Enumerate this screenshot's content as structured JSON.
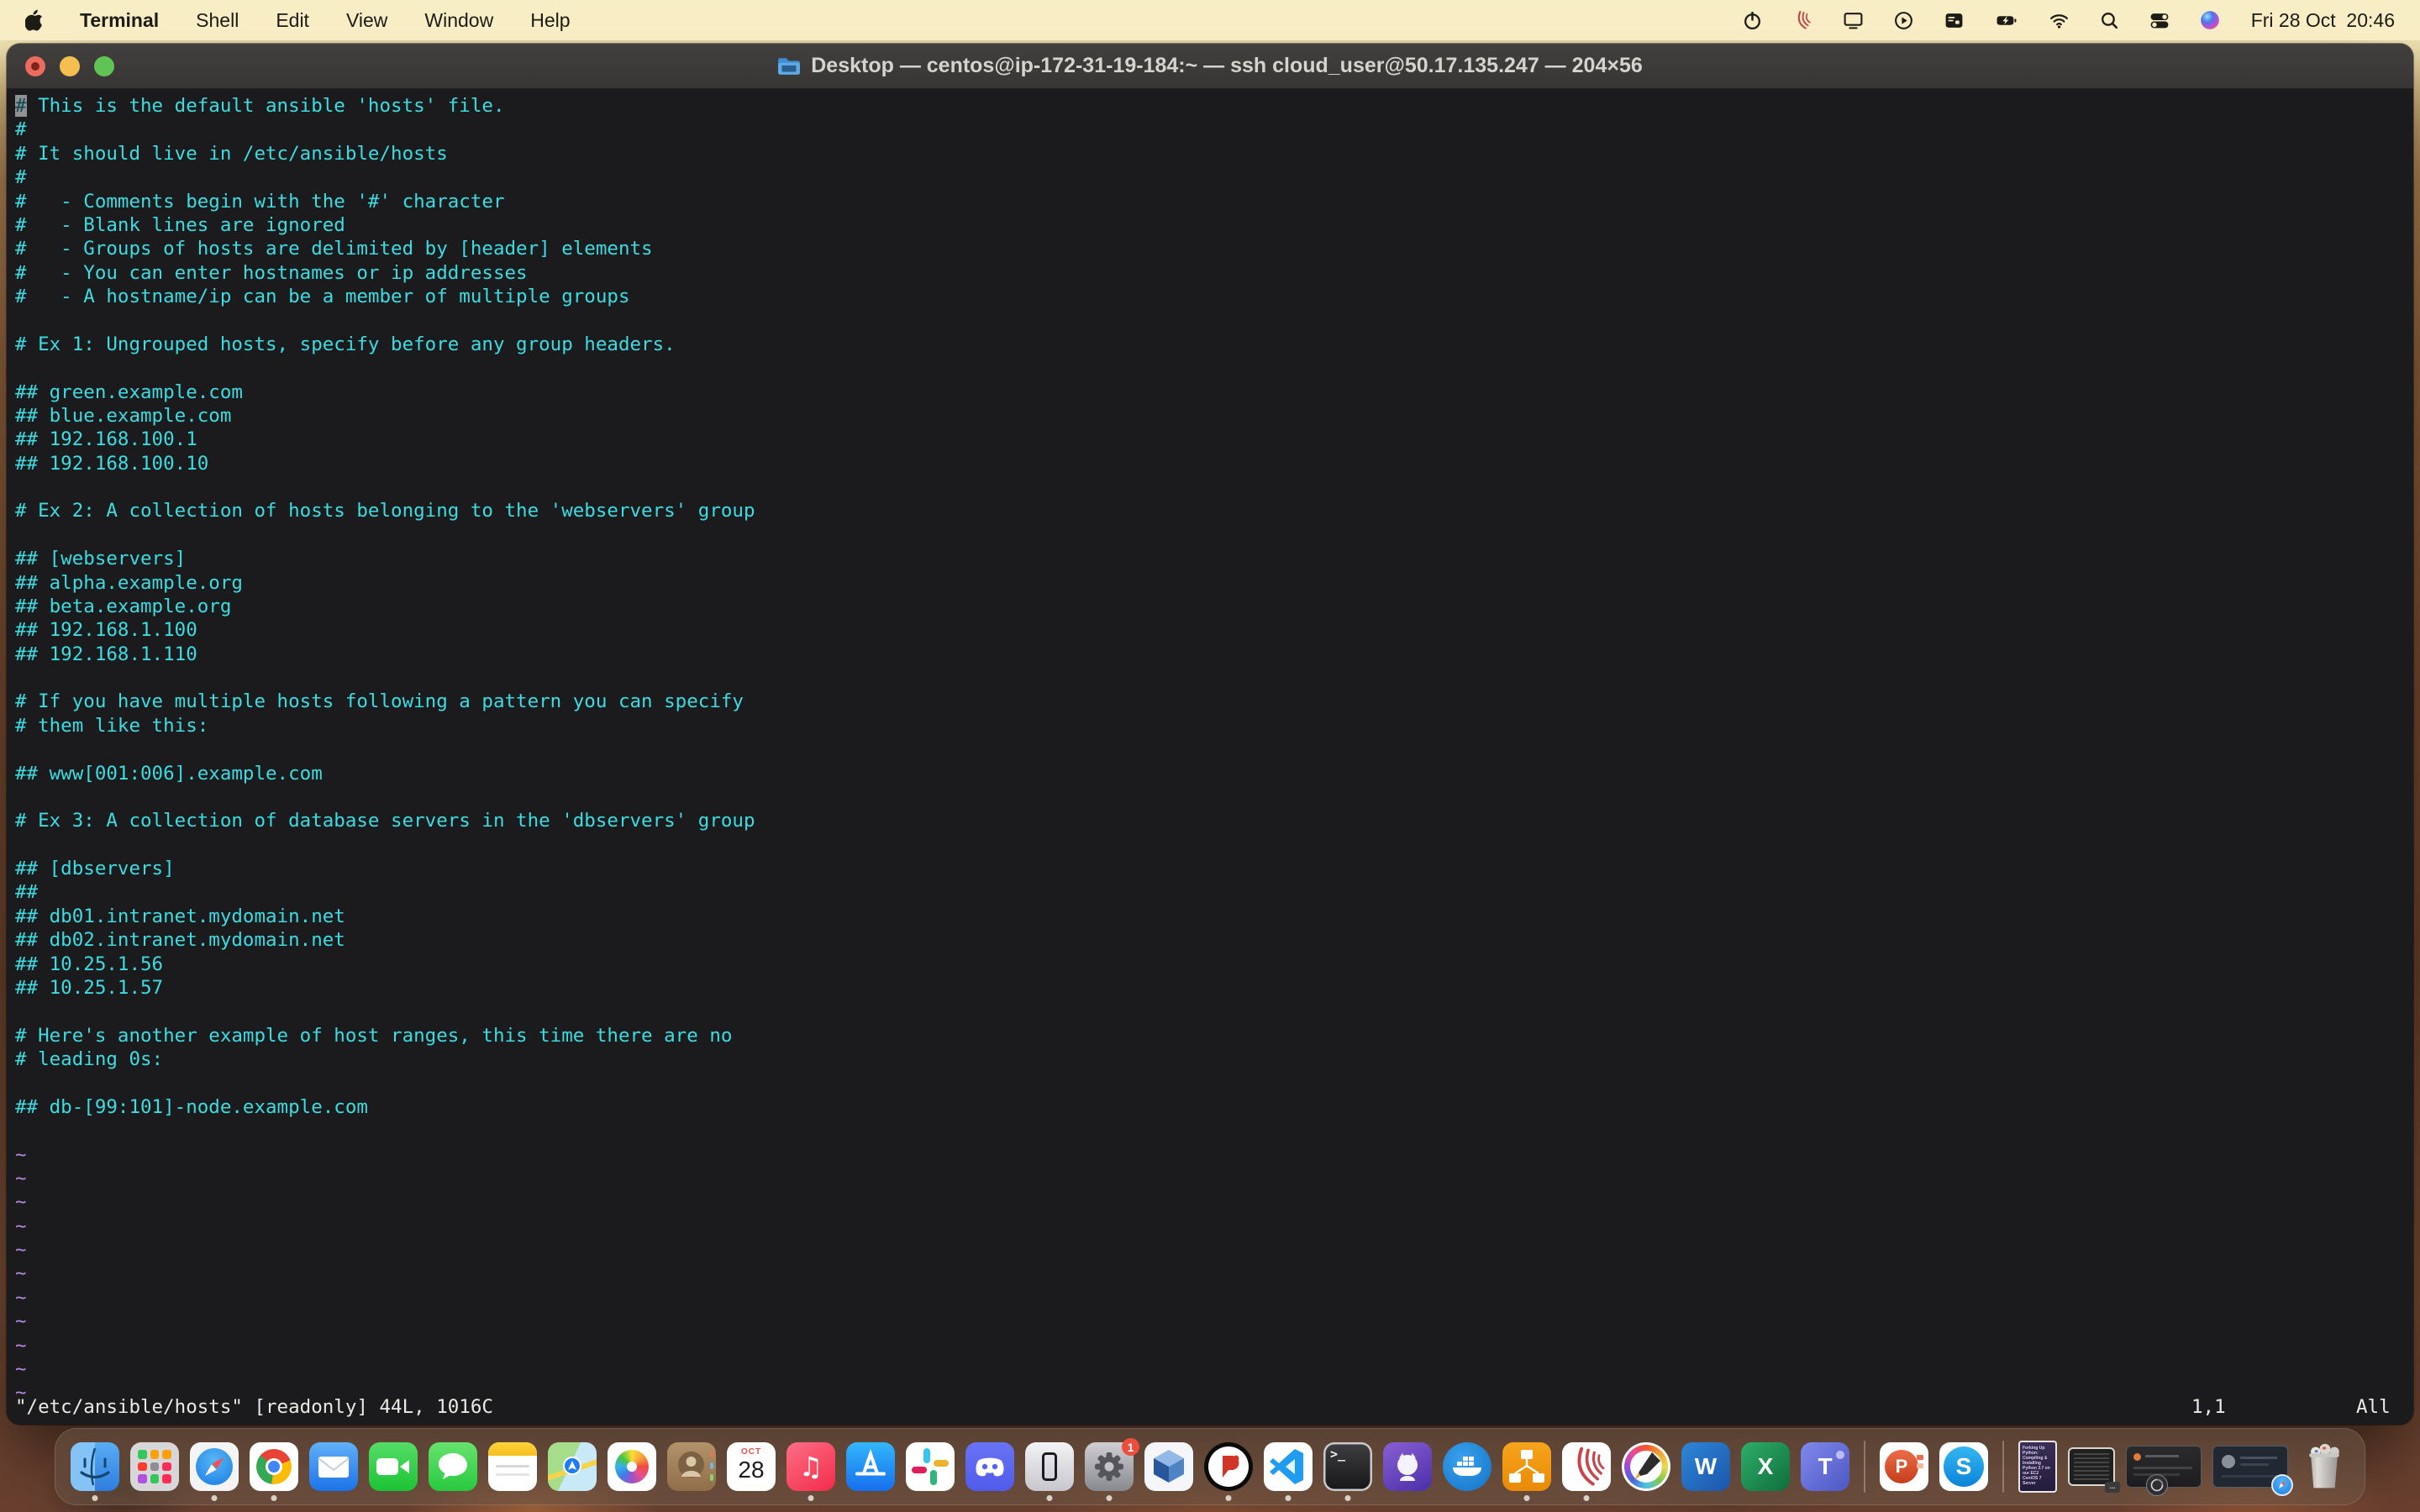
{
  "menubar": {
    "items": [
      {
        "label": "Terminal",
        "bold": true
      },
      {
        "label": "Shell"
      },
      {
        "label": "Edit"
      },
      {
        "label": "View"
      },
      {
        "label": "Window"
      },
      {
        "label": "Help"
      }
    ],
    "status_icons": [
      "power",
      "labex-waves",
      "screen-mirroring",
      "now-playing",
      "keyboard-window",
      "battery-charging",
      "wifi",
      "spotlight",
      "control-center",
      "siri"
    ],
    "clock": "Fri 28 Oct  20:46"
  },
  "window": {
    "title": "Desktop — centos@ip-172-31-19-184:~ — ssh cloud_user@50.17.135.247 — 204×56"
  },
  "terminal": {
    "cursor": {
      "row": 0,
      "col": 0
    },
    "lines": [
      "# This is the default ansible 'hosts' file.",
      "#",
      "# It should live in /etc/ansible/hosts",
      "#",
      "#   - Comments begin with the '#' character",
      "#   - Blank lines are ignored",
      "#   - Groups of hosts are delimited by [header] elements",
      "#   - You can enter hostnames or ip addresses",
      "#   - A hostname/ip can be a member of multiple groups",
      "",
      "# Ex 1: Ungrouped hosts, specify before any group headers.",
      "",
      "## green.example.com",
      "## blue.example.com",
      "## 192.168.100.1",
      "## 192.168.100.10",
      "",
      "# Ex 2: A collection of hosts belonging to the 'webservers' group",
      "",
      "## [webservers]",
      "## alpha.example.org",
      "## beta.example.org",
      "## 192.168.1.100",
      "## 192.168.1.110",
      "",
      "# If you have multiple hosts following a pattern you can specify",
      "# them like this:",
      "",
      "## www[001:006].example.com",
      "",
      "# Ex 3: A collection of database servers in the 'dbservers' group",
      "",
      "## [dbservers]",
      "##",
      "## db01.intranet.mydomain.net",
      "## db02.intranet.mydomain.net",
      "## 10.25.1.56",
      "## 10.25.1.57",
      "",
      "# Here's another example of host ranges, this time there are no",
      "# leading 0s:",
      "",
      "## db-[99:101]-node.example.com",
      ""
    ],
    "tilde": "~",
    "tilde_count": 11,
    "status": {
      "left": "\"/etc/ansible/hosts\" [readonly] 44L, 1016C",
      "ruler": "1,1",
      "scroll": "All"
    },
    "colors": {
      "bg": "#1b1a1c",
      "text": "#3adde2",
      "tilde": "#b487e3",
      "status": "#eceae6",
      "cursor_bg": "#8f9193",
      "cursor_text": "#0c4a50"
    }
  },
  "dock": {
    "items": [
      {
        "name": "finder",
        "running": true
      },
      {
        "name": "launchpad",
        "running": false
      },
      {
        "name": "safari",
        "running": true
      },
      {
        "name": "chrome",
        "running": true
      },
      {
        "name": "mail",
        "running": false
      },
      {
        "name": "facetime",
        "running": false
      },
      {
        "name": "messages",
        "running": false
      },
      {
        "name": "notes",
        "running": false
      },
      {
        "name": "maps",
        "running": false
      },
      {
        "name": "photos",
        "running": false
      },
      {
        "name": "contacts",
        "running": false
      },
      {
        "name": "calendar",
        "running": false,
        "month": "OCT",
        "day": "28"
      },
      {
        "name": "music",
        "running": true
      },
      {
        "name": "app-store",
        "running": false
      },
      {
        "name": "slack",
        "running": false
      },
      {
        "name": "discord",
        "running": false
      },
      {
        "name": "iphone-mirroring",
        "running": true
      },
      {
        "name": "system-settings",
        "running": true,
        "badge": "1"
      },
      {
        "name": "virtualbox",
        "running": false
      },
      {
        "name": "red-circle-app",
        "running": true
      },
      {
        "name": "vscode",
        "running": true
      },
      {
        "name": "terminal",
        "running": true
      },
      {
        "name": "github-desktop",
        "running": false
      },
      {
        "name": "docker",
        "running": false
      },
      {
        "name": "drawio",
        "running": true
      },
      {
        "name": "labex",
        "running": true
      },
      {
        "name": "krita",
        "running": false
      },
      {
        "name": "word",
        "running": false
      },
      {
        "name": "excel",
        "running": false
      },
      {
        "name": "teams",
        "running": false
      },
      {
        "name": "divider"
      },
      {
        "name": "powerpoint",
        "running": false
      },
      {
        "name": "skype",
        "running": false
      },
      {
        "name": "divider"
      },
      {
        "name": "minimized-doc",
        "thumb": true,
        "title": "Forking Up Python: Compiling & Installing Python 3.7 on our EC2 CentOS 7 Server"
      },
      {
        "name": "minimized-terminal",
        "thumb": true,
        "overlay": "…"
      },
      {
        "name": "minimized-window-gear",
        "thumb": true
      },
      {
        "name": "minimized-window-safari",
        "thumb": true
      },
      {
        "name": "trash",
        "running": false
      }
    ]
  }
}
